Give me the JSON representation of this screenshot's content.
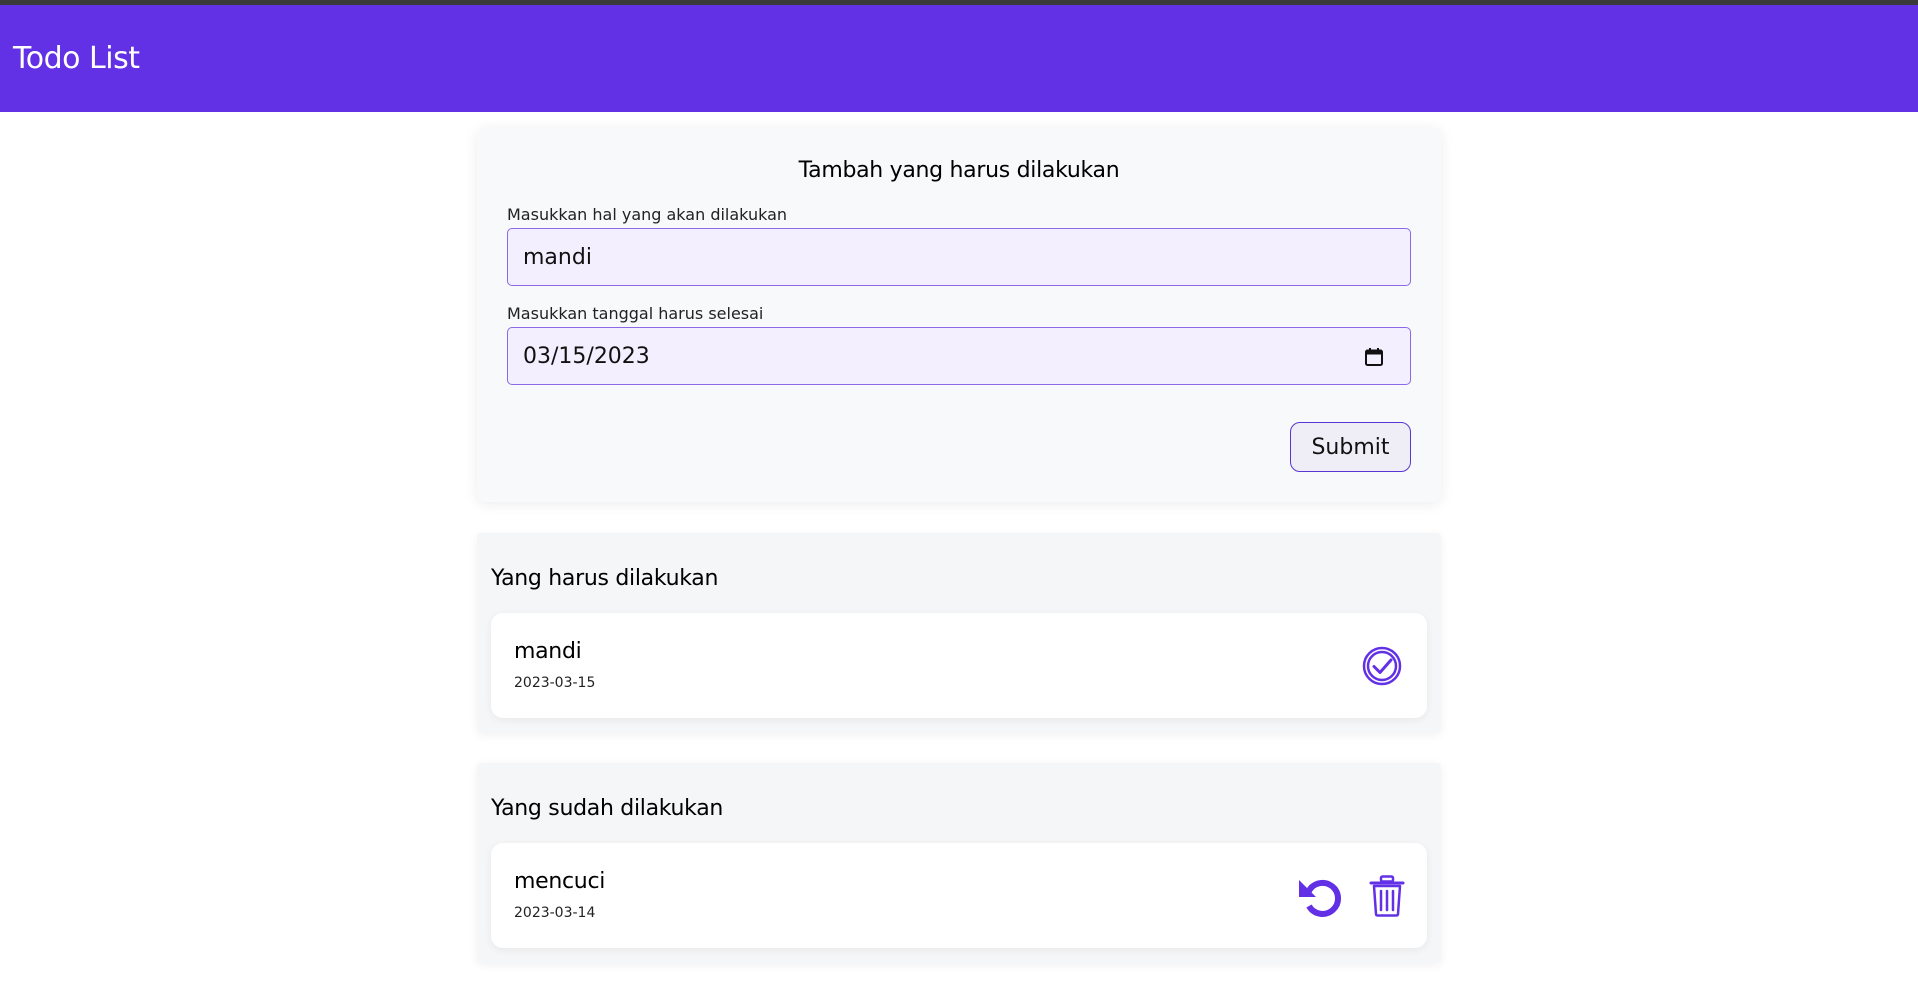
{
  "app": {
    "title": "Todo List"
  },
  "form": {
    "title": "Tambah yang harus dilakukan",
    "title_label": "Masukkan hal yang akan dilakukan",
    "title_value": "mandi",
    "date_label": "Masukkan tanggal harus selesai",
    "date_value": "03/15/2023",
    "submit_label": "Submit"
  },
  "incomplete": {
    "heading": "Yang harus dilakukan",
    "items": [
      {
        "title": "mandi",
        "date": "2023-03-15",
        "action_icon": "check-circle-icon"
      }
    ]
  },
  "completed": {
    "heading": "Yang sudah dilakukan",
    "items": [
      {
        "title": "mencuci",
        "date": "2023-03-14",
        "action_icons": [
          "undo-icon",
          "trash-icon"
        ]
      }
    ]
  },
  "colors": {
    "brand": "#6231e6",
    "accent": "#5a36d6",
    "input_bg": "#f3efff"
  }
}
